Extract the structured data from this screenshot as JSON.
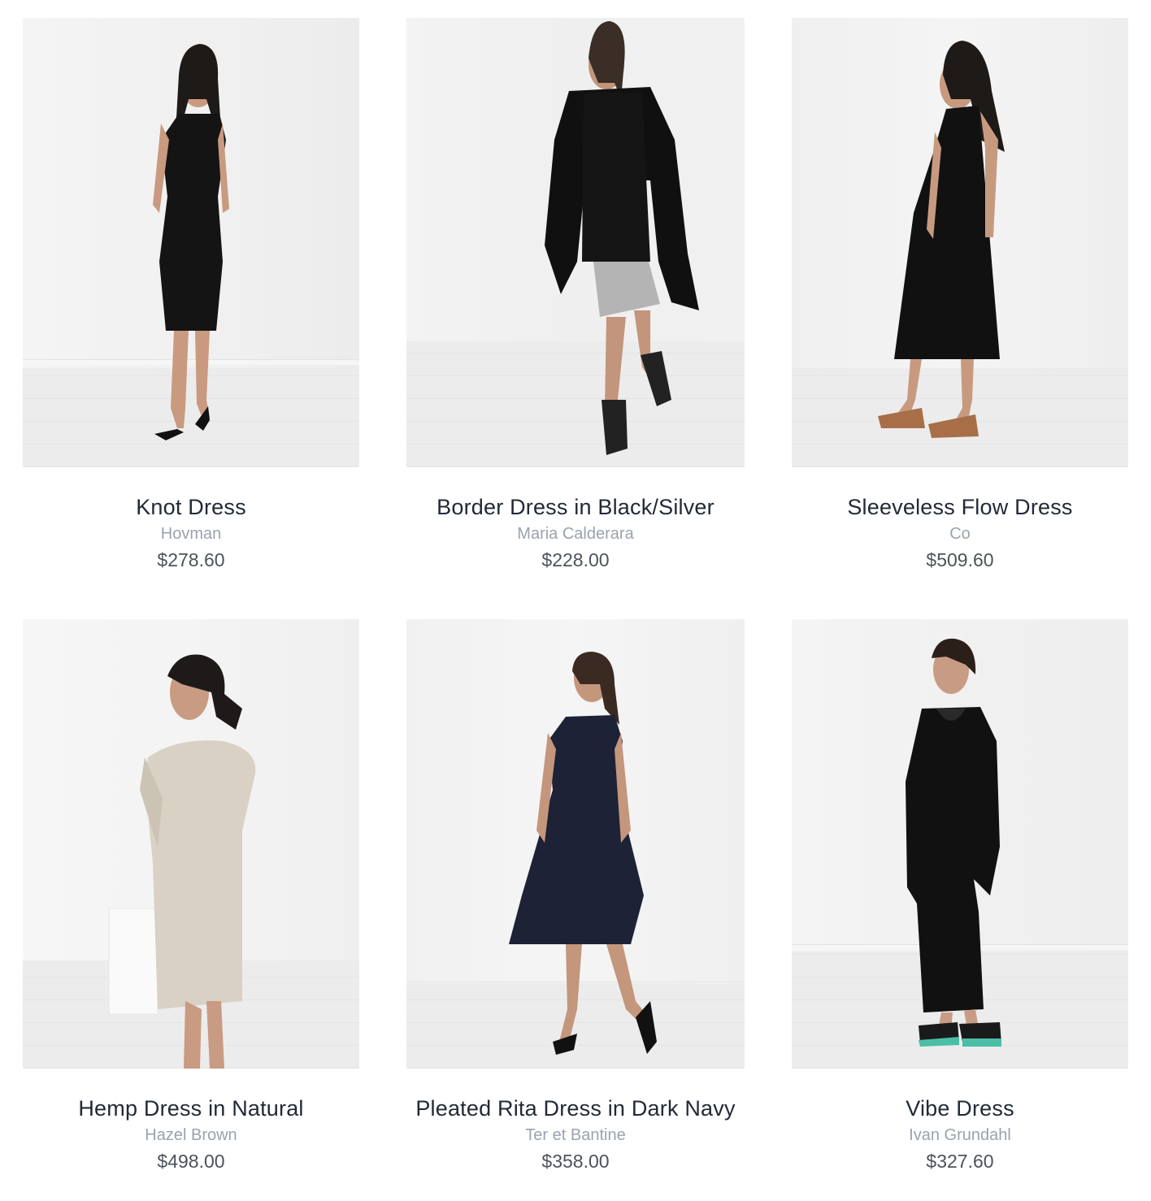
{
  "products": [
    {
      "title": "Knot Dress",
      "brand": "Hovman",
      "price": "$278.60",
      "image": "model-black-knot-dress-photo"
    },
    {
      "title": "Border Dress in Black/Silver",
      "brand": "Maria Calderara",
      "price": "$228.00",
      "image": "model-black-silver-dress-coat-photo"
    },
    {
      "title": "Sleeveless Flow Dress",
      "brand": "Co",
      "price": "$509.60",
      "image": "model-sleeveless-black-dress-photo"
    },
    {
      "title": "Hemp Dress in Natural",
      "brand": "Hazel Brown",
      "price": "$498.00",
      "image": "model-natural-hemp-dress-photo"
    },
    {
      "title": "Pleated Rita Dress in Dark Navy",
      "brand": "Ter et Bantine",
      "price": "$358.00",
      "image": "model-navy-pleated-dress-photo"
    },
    {
      "title": "Vibe Dress",
      "brand": "Ivan Grundahl",
      "price": "$327.60",
      "image": "model-black-vibe-dress-photo"
    }
  ],
  "colors": {
    "title": "#222a36",
    "brand": "#9aa3ad",
    "price": "#4b535c",
    "background": "#ffffff"
  }
}
